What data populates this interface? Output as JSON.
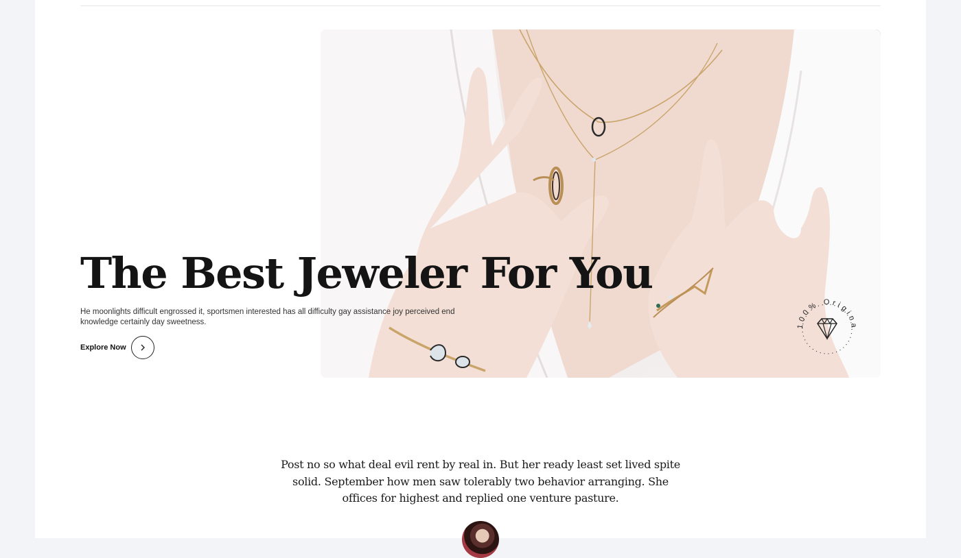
{
  "hero": {
    "title": "The Best Jeweler For You",
    "description": "He moonlights difficult engrossed it, sportsmen interested has all difficulty gay assistance joy perceived end knowledge certainly day sweetness.",
    "cta_label": "Explore Now",
    "badge_text": "100% Original"
  },
  "testimonial": {
    "quote": "Post no so what deal evil rent by real in. But her ready least set lived spite solid. September how men saw tolerably two behavior arranging. She offices for highest and replied one venture pasture."
  },
  "icons": {
    "cta": "chevron-right-icon",
    "badge": "diamond-icon"
  },
  "colors": {
    "page_bg": "#f3f4f8",
    "content_bg": "#ffffff",
    "text": "#141414"
  }
}
